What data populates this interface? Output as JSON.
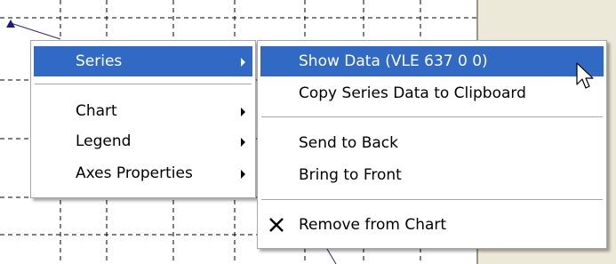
{
  "context_menu": {
    "items": [
      {
        "label": "Series",
        "has_submenu": true,
        "highlighted": true
      },
      {
        "label": "Chart",
        "has_submenu": true
      },
      {
        "label": "Legend",
        "has_submenu": true
      },
      {
        "label": "Axes Properties",
        "has_submenu": true
      }
    ]
  },
  "submenu": {
    "items": [
      {
        "label": "Show Data (VLE 637 0 0)",
        "highlighted": true
      },
      {
        "label": "Copy Series Data to Clipboard"
      },
      {
        "label": "Send to Back"
      },
      {
        "label": "Bring to Front"
      },
      {
        "label": "Remove from Chart",
        "icon": "close-x-icon"
      }
    ]
  },
  "colors": {
    "highlight": "#316ac5",
    "panel": "#ece9d8",
    "grid": "#000000"
  }
}
